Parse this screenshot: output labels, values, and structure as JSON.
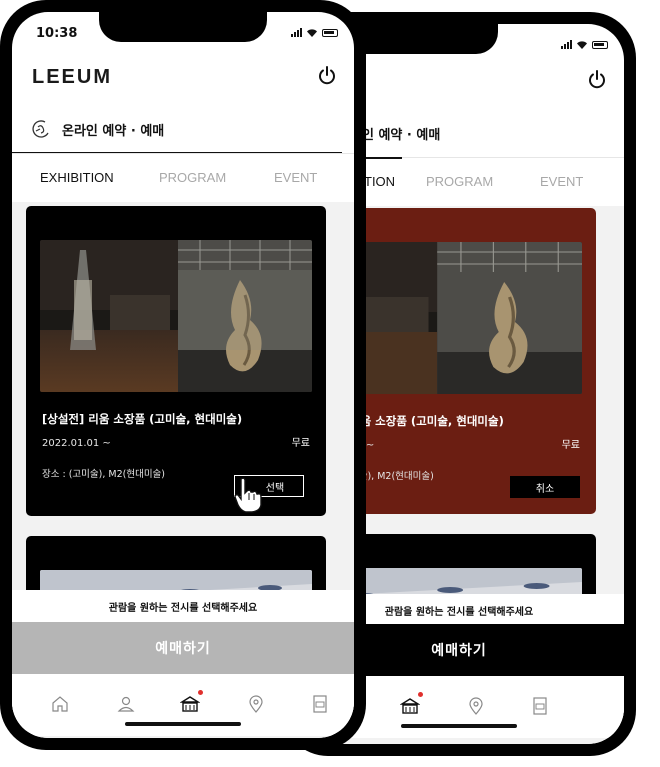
{
  "status": {
    "time": "10:38"
  },
  "app": {
    "logo": "LEEUM",
    "logo_cropped": "M"
  },
  "section": {
    "title": "온라인 예약 · 예매",
    "title_cropped": "라인 예약 · 예매"
  },
  "tabs": [
    {
      "label": "EXHIBITION",
      "label_cropped": "TION",
      "active": true
    },
    {
      "label": "PROGRAM",
      "active": false
    },
    {
      "label": "EVENT",
      "active": false
    }
  ],
  "exhibition": {
    "title": "[상설전] 리움 소장품 (고미술, 현대미술)",
    "title_cropped": "리움 소장품 (고미술, 현대미술)",
    "date": "2022.01.01 ~",
    "date_cropped": "01 ~",
    "price": "무료",
    "place": "장소 : (고미술), M2(현대미술)",
    "place_cropped": "미술), M2(현대미술)",
    "select_label": "선택",
    "cancel_label": "취소"
  },
  "notice": "관람을 원하는 전시를 선택해주세요",
  "book_button": "예매하기",
  "colors": {
    "card_dark": "#000000",
    "card_selected": "#6b1e12",
    "book_disabled": "#b5b5b5",
    "book_enabled": "#000000",
    "badge_dot": "#e0302d"
  },
  "nav_icons": [
    "home-icon",
    "user-icon",
    "museum-icon",
    "location-pin-icon",
    "ticket-icon"
  ]
}
